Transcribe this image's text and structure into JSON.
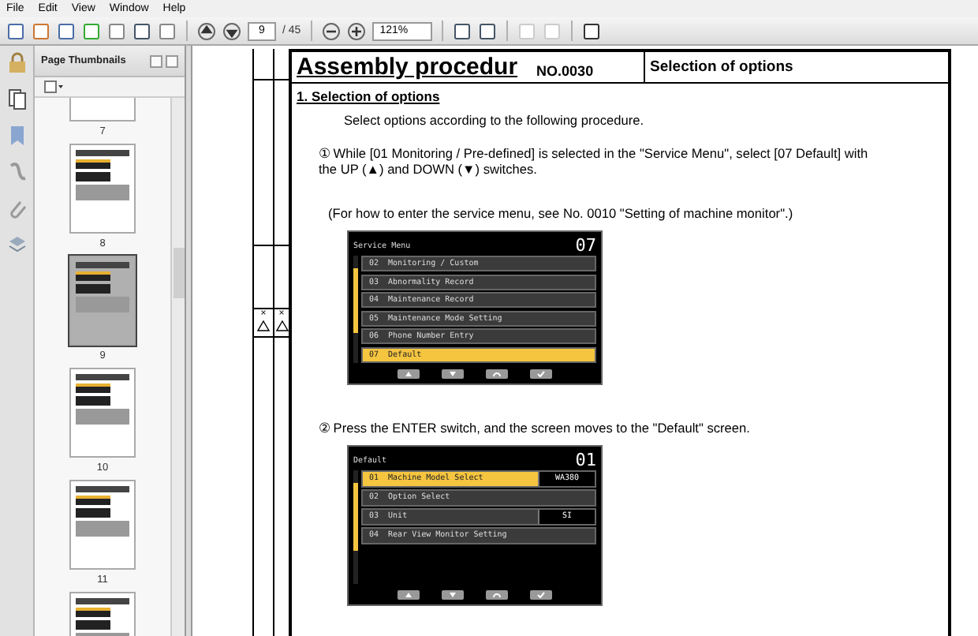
{
  "menu": [
    "File",
    "Edit",
    "View",
    "Window",
    "Help"
  ],
  "toolbar": {
    "page": "9",
    "page_count": "/ 45",
    "zoom": "121%"
  },
  "sidebar": {
    "title": "Page Thumbnails",
    "thumbnails": [
      {
        "label": "7",
        "selected": false
      },
      {
        "label": "8",
        "selected": false
      },
      {
        "label": "9",
        "selected": true
      },
      {
        "label": "10",
        "selected": false
      },
      {
        "label": "11",
        "selected": false
      },
      {
        "selected": false
      }
    ]
  },
  "document": {
    "title": "Assembly procedur",
    "number": "NO.0030",
    "subject": "Selection of options",
    "margin_marks": [
      "×",
      "×"
    ],
    "heading": "1. Selection of options",
    "intro": "Select options according to the following procedure.",
    "step1": "① While [01 Monitoring / Pre-defined] is selected in the \"Service Menu\", select [07 Default] with the UP (▲) and DOWN (▼) switches.",
    "note": "(For how to enter the service menu, see No. 0010 \"Setting of machine monitor\".)",
    "screen1": {
      "title": "Service Menu",
      "number": "07",
      "items": [
        {
          "label": "02  Monitoring / Custom",
          "selected": false
        },
        {
          "label": "03  Abnormality Record",
          "selected": false
        },
        {
          "label": "04  Maintenance Record",
          "selected": false
        },
        {
          "label": "05  Maintenance Mode Setting",
          "selected": false
        },
        {
          "label": "06  Phone Number Entry",
          "selected": false
        },
        {
          "label": "07  Default",
          "selected": true
        }
      ]
    },
    "step2": "② Press the ENTER switch, and the screen moves to the \"Default\" screen.",
    "screen2": {
      "title": "Default",
      "number": "01",
      "items": [
        {
          "label": "01  Machine Model Select",
          "value": "WA380",
          "selected": true
        },
        {
          "label": "02  Option Select",
          "selected": false
        },
        {
          "label": "03  Unit",
          "value": "SI",
          "selected": false
        },
        {
          "label": "04  Rear View Monitor Setting",
          "selected": false
        }
      ]
    }
  }
}
